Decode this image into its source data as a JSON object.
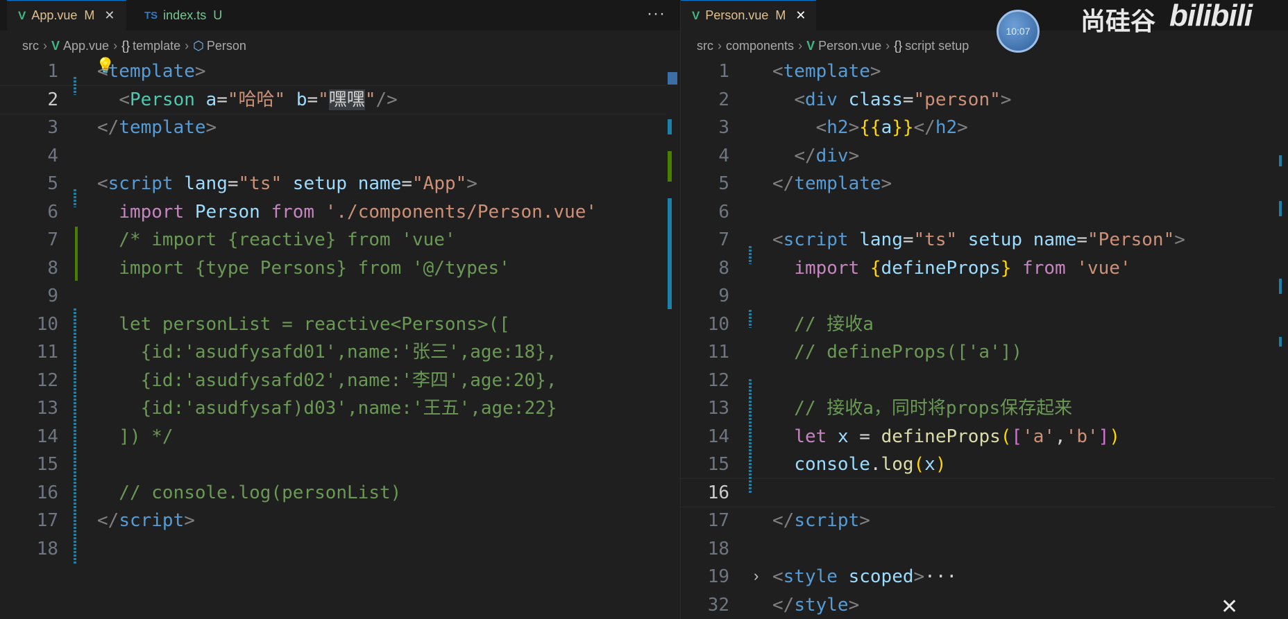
{
  "left": {
    "tabs": [
      {
        "label": "App.vue",
        "type": "vue",
        "status": "M",
        "active": true
      },
      {
        "label": "index.ts",
        "type": "ts",
        "type_label": "TS",
        "status": "U",
        "active": false
      }
    ],
    "more_label": "···",
    "breadcrumb": {
      "p1": "src",
      "p2": "App.vue",
      "p3": "template",
      "p4": "Person"
    },
    "current_line": 2,
    "lines": [
      [
        [
          "t",
          "<"
        ],
        [
          "tg",
          "template"
        ],
        [
          "t",
          ">"
        ]
      ],
      [
        [
          "pl",
          "  "
        ],
        [
          "t",
          "<"
        ],
        [
          "cl",
          "Person"
        ],
        [
          "pl",
          " "
        ],
        [
          "at",
          "a"
        ],
        [
          "pl",
          "="
        ],
        [
          "s",
          "\"哈哈\""
        ],
        [
          "pl",
          " "
        ],
        [
          "at",
          "b"
        ],
        [
          "pl",
          "="
        ],
        [
          "s",
          "\""
        ],
        [
          "sel",
          "嘿嘿"
        ],
        [
          "s",
          "\""
        ],
        [
          "t",
          "/>"
        ]
      ],
      [
        [
          "t",
          "</"
        ],
        [
          "tg",
          "template"
        ],
        [
          "t",
          ">"
        ]
      ],
      [],
      [
        [
          "t",
          "<"
        ],
        [
          "tg",
          "script"
        ],
        [
          "pl",
          " "
        ],
        [
          "at",
          "lang"
        ],
        [
          "pl",
          "="
        ],
        [
          "s",
          "\"ts\""
        ],
        [
          "pl",
          " "
        ],
        [
          "at",
          "setup"
        ],
        [
          "pl",
          " "
        ],
        [
          "at",
          "name"
        ],
        [
          "pl",
          "="
        ],
        [
          "s",
          "\"App\""
        ],
        [
          "t",
          ">"
        ]
      ],
      [
        [
          "pl",
          "  "
        ],
        [
          "k",
          "import"
        ],
        [
          "pl",
          " "
        ],
        [
          "v",
          "Person"
        ],
        [
          "pl",
          " "
        ],
        [
          "k",
          "from"
        ],
        [
          "pl",
          " "
        ],
        [
          "s",
          "'./components/Person.vue'"
        ]
      ],
      [
        [
          "c",
          "  /* import {reactive} from 'vue'"
        ]
      ],
      [
        [
          "c",
          "  import {type Persons} from '@/types'"
        ]
      ],
      [],
      [
        [
          "c",
          "  let personList = reactive<Persons>(["
        ]
      ],
      [
        [
          "c",
          "    {id:'asudfysafd01',name:'张三',age:18},"
        ]
      ],
      [
        [
          "c",
          "    {id:'asudfysafd02',name:'李四',age:20},"
        ]
      ],
      [
        [
          "c",
          "    {id:'asudfysaf)d03',name:'王五',age:22}"
        ]
      ],
      [
        [
          "c",
          "  ]) */"
        ]
      ],
      [],
      [
        [
          "c",
          "  // console.log(personList)"
        ]
      ],
      [
        [
          "t",
          "</"
        ],
        [
          "tg",
          "script"
        ],
        [
          "t",
          ">"
        ]
      ],
      []
    ]
  },
  "right": {
    "tabs": [
      {
        "label": "Person.vue",
        "type": "vue",
        "status": "M",
        "active": true
      }
    ],
    "breadcrumb": {
      "p1": "src",
      "p2": "components",
      "p3": "Person.vue",
      "p4": "script setup"
    },
    "current_line": 16,
    "lines": [
      {
        "n": "1",
        "seg": [
          [
            "t",
            "<"
          ],
          [
            "tg",
            "template"
          ],
          [
            "t",
            ">"
          ]
        ]
      },
      {
        "n": "2",
        "seg": [
          [
            "pl",
            "  "
          ],
          [
            "t",
            "<"
          ],
          [
            "tg",
            "div"
          ],
          [
            "pl",
            " "
          ],
          [
            "at",
            "class"
          ],
          [
            "pl",
            "="
          ],
          [
            "s",
            "\"person\""
          ],
          [
            "t",
            ">"
          ]
        ]
      },
      {
        "n": "3",
        "seg": [
          [
            "pl",
            "    "
          ],
          [
            "t",
            "<"
          ],
          [
            "tg",
            "h2"
          ],
          [
            "t",
            ">"
          ],
          [
            "b1",
            "{{"
          ],
          [
            "v",
            "a"
          ],
          [
            "b1",
            "}}"
          ],
          [
            "t",
            "</"
          ],
          [
            "tg",
            "h2"
          ],
          [
            "t",
            ">"
          ]
        ]
      },
      {
        "n": "4",
        "seg": [
          [
            "pl",
            "  "
          ],
          [
            "t",
            "</"
          ],
          [
            "tg",
            "div"
          ],
          [
            "t",
            ">"
          ]
        ]
      },
      {
        "n": "5",
        "seg": [
          [
            "t",
            "</"
          ],
          [
            "tg",
            "template"
          ],
          [
            "t",
            ">"
          ]
        ]
      },
      {
        "n": "6",
        "seg": []
      },
      {
        "n": "7",
        "seg": [
          [
            "t",
            "<"
          ],
          [
            "tg",
            "script"
          ],
          [
            "pl",
            " "
          ],
          [
            "at",
            "lang"
          ],
          [
            "pl",
            "="
          ],
          [
            "s",
            "\"ts\""
          ],
          [
            "pl",
            " "
          ],
          [
            "at",
            "setup"
          ],
          [
            "pl",
            " "
          ],
          [
            "at",
            "name"
          ],
          [
            "pl",
            "="
          ],
          [
            "s",
            "\"Person\""
          ],
          [
            "t",
            ">"
          ]
        ]
      },
      {
        "n": "8",
        "seg": [
          [
            "pl",
            "  "
          ],
          [
            "k",
            "import"
          ],
          [
            "pl",
            " "
          ],
          [
            "b1",
            "{"
          ],
          [
            "v",
            "defineProps"
          ],
          [
            "b1",
            "}"
          ],
          [
            "pl",
            " "
          ],
          [
            "k",
            "from"
          ],
          [
            "pl",
            " "
          ],
          [
            "s",
            "'vue'"
          ]
        ]
      },
      {
        "n": "9",
        "seg": []
      },
      {
        "n": "10",
        "seg": [
          [
            "c",
            "  // 接收a"
          ]
        ]
      },
      {
        "n": "11",
        "seg": [
          [
            "c",
            "  // defineProps(['a'])"
          ]
        ]
      },
      {
        "n": "12",
        "seg": []
      },
      {
        "n": "13",
        "seg": [
          [
            "c",
            "  // 接收a，同时将props保存起来"
          ]
        ]
      },
      {
        "n": "14",
        "seg": [
          [
            "pl",
            "  "
          ],
          [
            "k",
            "let"
          ],
          [
            "pl",
            " "
          ],
          [
            "v",
            "x"
          ],
          [
            "pl",
            " = "
          ],
          [
            "fn",
            "defineProps"
          ],
          [
            "b1",
            "("
          ],
          [
            "b2",
            "["
          ],
          [
            "s",
            "'a'"
          ],
          [
            "pl",
            ","
          ],
          [
            "s",
            "'b'"
          ],
          [
            "b2",
            "]"
          ],
          [
            "b1",
            ")"
          ]
        ]
      },
      {
        "n": "15",
        "seg": [
          [
            "pl",
            "  "
          ],
          [
            "v",
            "console"
          ],
          [
            "pl",
            "."
          ],
          [
            "fn",
            "log"
          ],
          [
            "b1",
            "("
          ],
          [
            "v",
            "x"
          ],
          [
            "b1",
            ")"
          ]
        ]
      },
      {
        "n": "16",
        "seg": []
      },
      {
        "n": "17",
        "seg": [
          [
            "t",
            "</"
          ],
          [
            "tg",
            "script"
          ],
          [
            "t",
            ">"
          ]
        ]
      },
      {
        "n": "18",
        "seg": []
      },
      {
        "n": "19",
        "seg": [
          [
            "t",
            "<"
          ],
          [
            "tg",
            "style"
          ],
          [
            "pl",
            " "
          ],
          [
            "at",
            "scoped"
          ],
          [
            "t",
            ">"
          ],
          [
            "pl",
            "···"
          ]
        ]
      },
      {
        "n": "32",
        "seg": [
          [
            "t",
            "</"
          ],
          [
            "tg",
            "style"
          ],
          [
            "t",
            ">"
          ]
        ]
      }
    ]
  },
  "overlay": {
    "brand": "尚硅谷",
    "site": "bilibili",
    "time": "10:07"
  },
  "colors": {
    "accent": "#0078d4",
    "vue_green": "#41b883",
    "modified": "#e2c08d"
  }
}
